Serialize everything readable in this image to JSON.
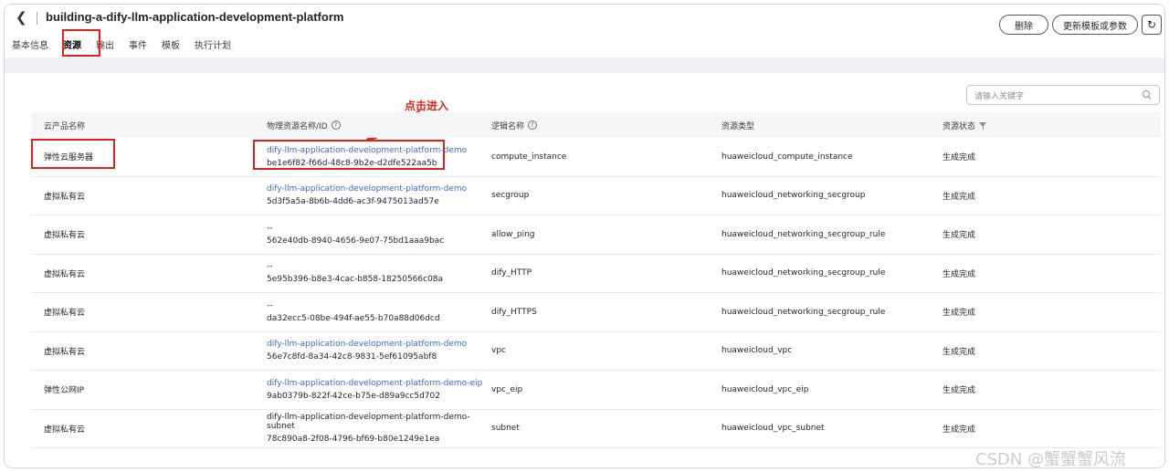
{
  "header": {
    "back_icon": "chevron-left",
    "title": "building-a-dify-llm-application-development-platform",
    "buttons": {
      "delete": "删除",
      "update": "更新模板或参数",
      "refresh_icon": "refresh"
    }
  },
  "tabs": [
    "基本信息",
    "资源",
    "输出",
    "事件",
    "模板",
    "执行计划"
  ],
  "active_tab": "资源",
  "search": {
    "placeholder": "请输入关键字"
  },
  "annotation": {
    "text": "点击进入",
    "color": "#e3211a"
  },
  "table": {
    "headers": {
      "product": "云产品名称",
      "physical": "物理资源名称/ID",
      "logical": "逻辑名称",
      "type": "资源类型",
      "status": "资源状态"
    },
    "rows": [
      {
        "product": "弹性云服务器",
        "name": "dify-llm-application-development-platform-demo",
        "name_is_link": true,
        "id": "be1e6f82-f66d-48c8-9b2e-d2dfe522aa5b",
        "logical": "compute_instance",
        "type": "huaweicloud_compute_instance",
        "status": "生成完成"
      },
      {
        "product": "虚拟私有云",
        "name": "dify-llm-application-development-platform-demo",
        "name_is_link": true,
        "id": "5d3f5a5a-8b6b-4dd6-ac3f-9475013ad57e",
        "logical": "secgroup",
        "type": "huaweicloud_networking_secgroup",
        "status": "生成完成"
      },
      {
        "product": "虚拟私有云",
        "name": "--",
        "name_is_link": false,
        "id": "562e40db-8940-4656-9e07-75bd1aaa9bac",
        "logical": "allow_ping",
        "type": "huaweicloud_networking_secgroup_rule",
        "status": "生成完成"
      },
      {
        "product": "虚拟私有云",
        "name": "--",
        "name_is_link": false,
        "id": "5e95b396-b8e3-4cac-b858-18250566c08a",
        "logical": "dify_HTTP",
        "type": "huaweicloud_networking_secgroup_rule",
        "status": "生成完成"
      },
      {
        "product": "虚拟私有云",
        "name": "--",
        "name_is_link": false,
        "id": "da32ecc5-08be-494f-ae55-b70a88d06dcd",
        "logical": "dify_HTTPS",
        "type": "huaweicloud_networking_secgroup_rule",
        "status": "生成完成"
      },
      {
        "product": "虚拟私有云",
        "name": "dify-llm-application-development-platform-demo",
        "name_is_link": true,
        "id": "56e7c8fd-8a34-42c8-9831-5ef61095abf8",
        "logical": "vpc",
        "type": "huaweicloud_vpc",
        "status": "生成完成"
      },
      {
        "product": "弹性公网IP",
        "name": "dify-llm-application-development-platform-demo-eip",
        "name_is_link": true,
        "id": "9ab0379b-822f-42ce-b75e-d89a9cc5d702",
        "logical": "vpc_eip",
        "type": "huaweicloud_vpc_eip",
        "status": "生成完成"
      },
      {
        "product": "虚拟私有云",
        "name": "dify-llm-application-development-platform-demo-subnet",
        "name_is_link": false,
        "id": "78c890a8-2f08-4796-bf69-b80e1249e1ea",
        "logical": "subnet",
        "type": "huaweicloud_vpc_subnet",
        "status": "生成完成"
      }
    ]
  },
  "watermark": "CSDN @蟹蟹蟹风流"
}
